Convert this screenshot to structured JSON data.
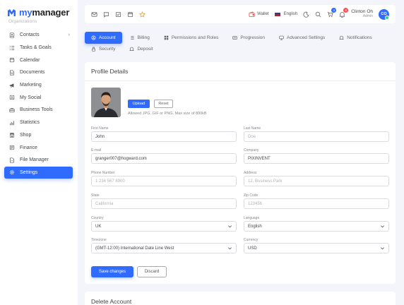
{
  "logo": {
    "prefix": "my",
    "suffix": "manager"
  },
  "sidebar": {
    "cut_item": "Organizations",
    "items": [
      {
        "label": "Contacts",
        "icon": "contacts-icon",
        "chevron": "›"
      },
      {
        "label": "Tasks & Goals",
        "icon": "tasks-icon"
      },
      {
        "label": "Calendar",
        "icon": "calendar-icon"
      },
      {
        "label": "Documents",
        "icon": "documents-icon"
      },
      {
        "label": "Marketing",
        "icon": "megaphone-icon"
      },
      {
        "label": "My Social",
        "icon": "social-icon"
      },
      {
        "label": "Business Tools",
        "icon": "briefcase-icon"
      },
      {
        "label": "Statistics",
        "icon": "statistics-icon"
      },
      {
        "label": "Shop",
        "icon": "shop-icon"
      },
      {
        "label": "Finance",
        "icon": "finance-icon"
      },
      {
        "label": "File Manager",
        "icon": "file-manager-icon"
      },
      {
        "label": "Settings",
        "icon": "settings-icon",
        "active": true
      }
    ]
  },
  "topbar": {
    "wallet_label": "Wallet",
    "language_label": "English",
    "cart_badge": "4",
    "notification_badge": "8",
    "user_name": "Clinton Oh",
    "user_role": "Admin",
    "user_initials": "CO"
  },
  "tabs": {
    "row1": [
      "Account",
      "Billing",
      "Permissions and Roles",
      "Progression",
      "Advanced Settings",
      "Notifications"
    ],
    "row2": [
      "Security",
      "Deposit"
    ]
  },
  "profile": {
    "title": "Profile Details",
    "upload_label": "Upload",
    "reset_label": "Reset",
    "photo_hint": "Allowed JPG, GIF or PNG. Max size of 800kB",
    "fields": {
      "first_name": {
        "label": "First Name",
        "value": "John"
      },
      "last_name": {
        "label": "Last Name",
        "placeholder": "Doe"
      },
      "email": {
        "label": "E-mail",
        "value": "granger007@hogward.com"
      },
      "company": {
        "label": "Company",
        "value": "PIXINVENT"
      },
      "phone": {
        "label": "Phone Number",
        "placeholder": "1 234 567 8900"
      },
      "address": {
        "label": "Address",
        "placeholder": "12, Business Park"
      },
      "state": {
        "label": "State",
        "placeholder": "California"
      },
      "zip": {
        "label": "Zip Code",
        "placeholder": "123456"
      },
      "country": {
        "label": "Country",
        "value": "UK"
      },
      "language": {
        "label": "Language",
        "value": "English"
      },
      "timezone": {
        "label": "Timezone",
        "value": "(GMT-12:00) International Date Line West"
      },
      "currency": {
        "label": "Currency",
        "value": "USD"
      }
    },
    "save_label": "Save changes",
    "discard_label": "Discard"
  },
  "delete_account": {
    "title": "Delete Account"
  },
  "colors": {
    "accent": "#2f6bff",
    "badge_blue": "#2f6bff",
    "badge_red": "#ff4c51"
  }
}
